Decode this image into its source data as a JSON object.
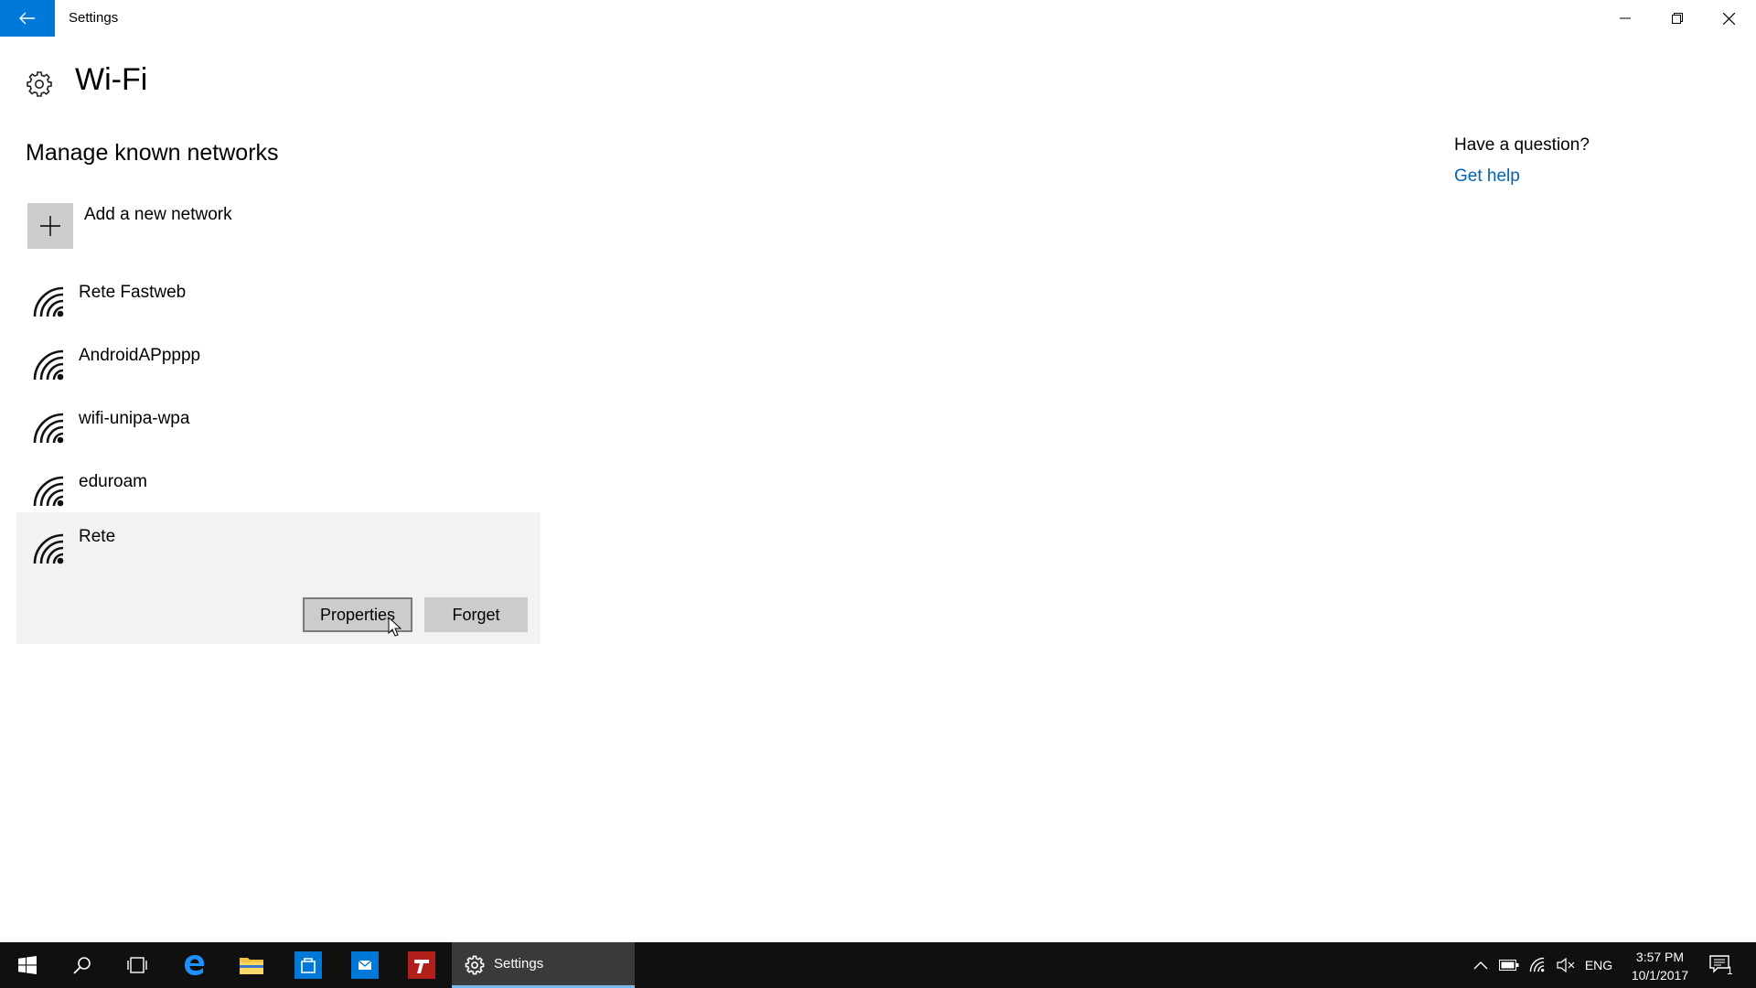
{
  "window": {
    "title": "Settings",
    "back_icon": "back-arrow-icon",
    "controls": [
      "minimize-icon",
      "restore-icon",
      "close-icon"
    ]
  },
  "page": {
    "title": "Wi-Fi",
    "icon": "gear-icon",
    "section_title": "Manage known networks",
    "add_network_label": "Add a new network"
  },
  "networks": [
    {
      "name": "Rete Fastweb"
    },
    {
      "name": "AndroidAPpppp"
    },
    {
      "name": "wifi-unipa-wpa"
    },
    {
      "name": "eduroam"
    },
    {
      "name": "Rete",
      "selected": true
    }
  ],
  "selected_actions": {
    "properties_label": "Properties",
    "forget_label": "Forget"
  },
  "help": {
    "question": "Have a question?",
    "link": "Get help"
  },
  "taskbar": {
    "active_app_label": "Settings",
    "language": "ENG",
    "time": "3:57 PM",
    "date": "10/1/2017",
    "notification_count": "1"
  },
  "colors": {
    "accent": "#0078d7",
    "link": "#0063b1",
    "taskbar": "#101010",
    "selected_bg": "#f2f2f2",
    "button_bg": "#cccccc"
  }
}
